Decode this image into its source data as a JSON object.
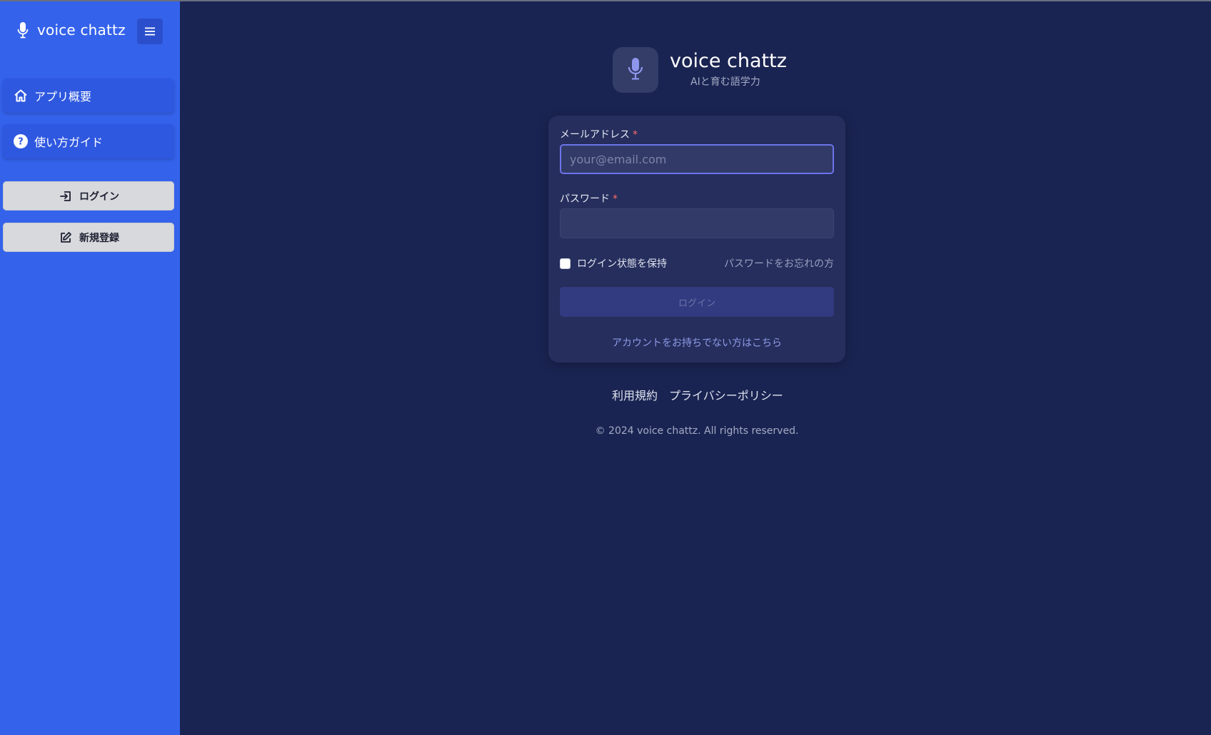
{
  "brand": {
    "name": "voice chattz",
    "icon": "microphone-icon"
  },
  "sidebar": {
    "menu_icon": "hamburger-icon",
    "items": [
      {
        "label": "アプリ概要",
        "icon": "home-icon"
      },
      {
        "label": "使い方ガイド",
        "icon": "help-circle-icon"
      }
    ],
    "buttons": [
      {
        "label": "ログイン",
        "icon": "login-icon"
      },
      {
        "label": "新規登録",
        "icon": "edit-icon"
      }
    ]
  },
  "header": {
    "title": "voice chattz",
    "subtitle": "AIと育む語学力"
  },
  "form": {
    "email_label": "メールアドレス",
    "email_placeholder": "your@email.com",
    "password_label": "パスワード",
    "required_mark": "*",
    "remember_label": "ログイン状態を保持",
    "forgot_link": "パスワードをお忘れの方",
    "submit_label": "ログイン",
    "signup_link": "アカウントをお持ちでない方はこちら"
  },
  "footer": {
    "links": [
      "利用規約",
      "プライバシーポリシー"
    ],
    "copyright": "© 2024 voice chattz. All rights reserved."
  },
  "colors": {
    "sidebar_bg": "#3462eb",
    "main_bg": "#1a2452",
    "card_bg": "#252e5c",
    "accent": "#6d74ea",
    "required": "#ff6b6b"
  }
}
